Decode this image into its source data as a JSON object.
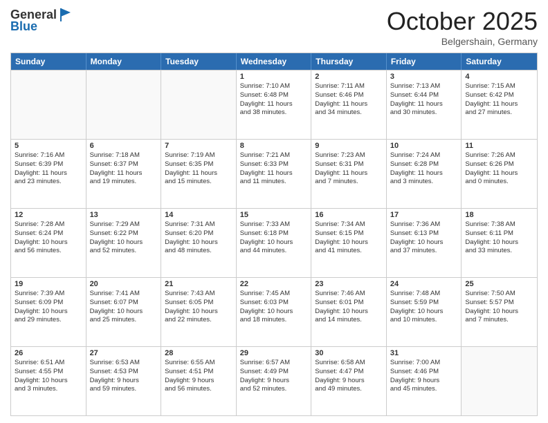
{
  "header": {
    "logo_line1": "General",
    "logo_line2": "Blue",
    "month": "October 2025",
    "location": "Belgershain, Germany"
  },
  "weekdays": [
    "Sunday",
    "Monday",
    "Tuesday",
    "Wednesday",
    "Thursday",
    "Friday",
    "Saturday"
  ],
  "rows": [
    [
      {
        "day": "",
        "empty": true,
        "lines": []
      },
      {
        "day": "",
        "empty": true,
        "lines": []
      },
      {
        "day": "",
        "empty": true,
        "lines": []
      },
      {
        "day": "1",
        "lines": [
          "Sunrise: 7:10 AM",
          "Sunset: 6:48 PM",
          "Daylight: 11 hours",
          "and 38 minutes."
        ]
      },
      {
        "day": "2",
        "lines": [
          "Sunrise: 7:11 AM",
          "Sunset: 6:46 PM",
          "Daylight: 11 hours",
          "and 34 minutes."
        ]
      },
      {
        "day": "3",
        "lines": [
          "Sunrise: 7:13 AM",
          "Sunset: 6:44 PM",
          "Daylight: 11 hours",
          "and 30 minutes."
        ]
      },
      {
        "day": "4",
        "lines": [
          "Sunrise: 7:15 AM",
          "Sunset: 6:42 PM",
          "Daylight: 11 hours",
          "and 27 minutes."
        ]
      }
    ],
    [
      {
        "day": "5",
        "lines": [
          "Sunrise: 7:16 AM",
          "Sunset: 6:39 PM",
          "Daylight: 11 hours",
          "and 23 minutes."
        ]
      },
      {
        "day": "6",
        "lines": [
          "Sunrise: 7:18 AM",
          "Sunset: 6:37 PM",
          "Daylight: 11 hours",
          "and 19 minutes."
        ]
      },
      {
        "day": "7",
        "lines": [
          "Sunrise: 7:19 AM",
          "Sunset: 6:35 PM",
          "Daylight: 11 hours",
          "and 15 minutes."
        ]
      },
      {
        "day": "8",
        "lines": [
          "Sunrise: 7:21 AM",
          "Sunset: 6:33 PM",
          "Daylight: 11 hours",
          "and 11 minutes."
        ]
      },
      {
        "day": "9",
        "lines": [
          "Sunrise: 7:23 AM",
          "Sunset: 6:31 PM",
          "Daylight: 11 hours",
          "and 7 minutes."
        ]
      },
      {
        "day": "10",
        "lines": [
          "Sunrise: 7:24 AM",
          "Sunset: 6:28 PM",
          "Daylight: 11 hours",
          "and 3 minutes."
        ]
      },
      {
        "day": "11",
        "lines": [
          "Sunrise: 7:26 AM",
          "Sunset: 6:26 PM",
          "Daylight: 11 hours",
          "and 0 minutes."
        ]
      }
    ],
    [
      {
        "day": "12",
        "lines": [
          "Sunrise: 7:28 AM",
          "Sunset: 6:24 PM",
          "Daylight: 10 hours",
          "and 56 minutes."
        ]
      },
      {
        "day": "13",
        "lines": [
          "Sunrise: 7:29 AM",
          "Sunset: 6:22 PM",
          "Daylight: 10 hours",
          "and 52 minutes."
        ]
      },
      {
        "day": "14",
        "lines": [
          "Sunrise: 7:31 AM",
          "Sunset: 6:20 PM",
          "Daylight: 10 hours",
          "and 48 minutes."
        ]
      },
      {
        "day": "15",
        "lines": [
          "Sunrise: 7:33 AM",
          "Sunset: 6:18 PM",
          "Daylight: 10 hours",
          "and 44 minutes."
        ]
      },
      {
        "day": "16",
        "lines": [
          "Sunrise: 7:34 AM",
          "Sunset: 6:15 PM",
          "Daylight: 10 hours",
          "and 41 minutes."
        ]
      },
      {
        "day": "17",
        "lines": [
          "Sunrise: 7:36 AM",
          "Sunset: 6:13 PM",
          "Daylight: 10 hours",
          "and 37 minutes."
        ]
      },
      {
        "day": "18",
        "lines": [
          "Sunrise: 7:38 AM",
          "Sunset: 6:11 PM",
          "Daylight: 10 hours",
          "and 33 minutes."
        ]
      }
    ],
    [
      {
        "day": "19",
        "lines": [
          "Sunrise: 7:39 AM",
          "Sunset: 6:09 PM",
          "Daylight: 10 hours",
          "and 29 minutes."
        ]
      },
      {
        "day": "20",
        "lines": [
          "Sunrise: 7:41 AM",
          "Sunset: 6:07 PM",
          "Daylight: 10 hours",
          "and 25 minutes."
        ]
      },
      {
        "day": "21",
        "lines": [
          "Sunrise: 7:43 AM",
          "Sunset: 6:05 PM",
          "Daylight: 10 hours",
          "and 22 minutes."
        ]
      },
      {
        "day": "22",
        "lines": [
          "Sunrise: 7:45 AM",
          "Sunset: 6:03 PM",
          "Daylight: 10 hours",
          "and 18 minutes."
        ]
      },
      {
        "day": "23",
        "lines": [
          "Sunrise: 7:46 AM",
          "Sunset: 6:01 PM",
          "Daylight: 10 hours",
          "and 14 minutes."
        ]
      },
      {
        "day": "24",
        "lines": [
          "Sunrise: 7:48 AM",
          "Sunset: 5:59 PM",
          "Daylight: 10 hours",
          "and 10 minutes."
        ]
      },
      {
        "day": "25",
        "lines": [
          "Sunrise: 7:50 AM",
          "Sunset: 5:57 PM",
          "Daylight: 10 hours",
          "and 7 minutes."
        ]
      }
    ],
    [
      {
        "day": "26",
        "lines": [
          "Sunrise: 6:51 AM",
          "Sunset: 4:55 PM",
          "Daylight: 10 hours",
          "and 3 minutes."
        ]
      },
      {
        "day": "27",
        "lines": [
          "Sunrise: 6:53 AM",
          "Sunset: 4:53 PM",
          "Daylight: 9 hours",
          "and 59 minutes."
        ]
      },
      {
        "day": "28",
        "lines": [
          "Sunrise: 6:55 AM",
          "Sunset: 4:51 PM",
          "Daylight: 9 hours",
          "and 56 minutes."
        ]
      },
      {
        "day": "29",
        "lines": [
          "Sunrise: 6:57 AM",
          "Sunset: 4:49 PM",
          "Daylight: 9 hours",
          "and 52 minutes."
        ]
      },
      {
        "day": "30",
        "lines": [
          "Sunrise: 6:58 AM",
          "Sunset: 4:47 PM",
          "Daylight: 9 hours",
          "and 49 minutes."
        ]
      },
      {
        "day": "31",
        "lines": [
          "Sunrise: 7:00 AM",
          "Sunset: 4:46 PM",
          "Daylight: 9 hours",
          "and 45 minutes."
        ]
      },
      {
        "day": "",
        "empty": true,
        "lines": []
      }
    ]
  ]
}
